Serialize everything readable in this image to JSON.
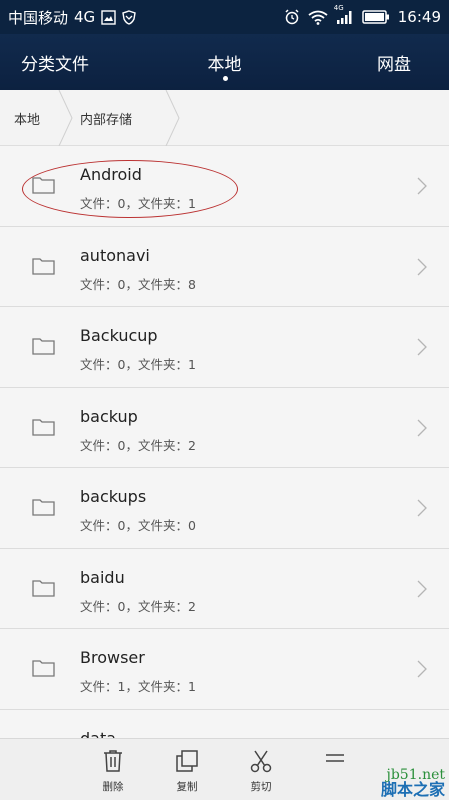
{
  "status_bar": {
    "carrier": "中国移动",
    "network": "4G",
    "signal_badge": "4G",
    "time": "16:49",
    "icons": [
      "image-icon",
      "shield-icon",
      "alarm-icon",
      "wifi-icon",
      "signal-icon",
      "battery-icon"
    ]
  },
  "tabs": [
    {
      "label": "分类文件",
      "active": false
    },
    {
      "label": "本地",
      "active": true
    },
    {
      "label": "网盘",
      "active": false
    }
  ],
  "breadcrumb": [
    "本地",
    "内部存储"
  ],
  "files": [
    {
      "name": "Android",
      "meta": "文件：0，文件夹：1"
    },
    {
      "name": "autonavi",
      "meta": "文件：0，文件夹：8"
    },
    {
      "name": "Backucup",
      "meta": "文件：0，文件夹：1"
    },
    {
      "name": "backup",
      "meta": "文件：0，文件夹：2"
    },
    {
      "name": "backups",
      "meta": "文件：0，文件夹：0"
    },
    {
      "name": "baidu",
      "meta": "文件：0，文件夹：2"
    },
    {
      "name": "Browser",
      "meta": "文件：1，文件夹：1"
    },
    {
      "name": "data",
      "meta": ""
    }
  ],
  "actions": [
    {
      "label": "删除",
      "icon": "trash-icon"
    },
    {
      "label": "复制",
      "icon": "copy-icon"
    },
    {
      "label": "剪切",
      "icon": "scissors-icon"
    },
    {
      "label": "",
      "icon": "more-icon"
    }
  ],
  "watermark": {
    "line1": "jb51.net",
    "line2": "脚本之家"
  },
  "colors": {
    "header": "#0c2340",
    "highlight": "#bb3333",
    "watermark_green": "#2a8f3a",
    "watermark_blue": "#1d6fb4"
  }
}
